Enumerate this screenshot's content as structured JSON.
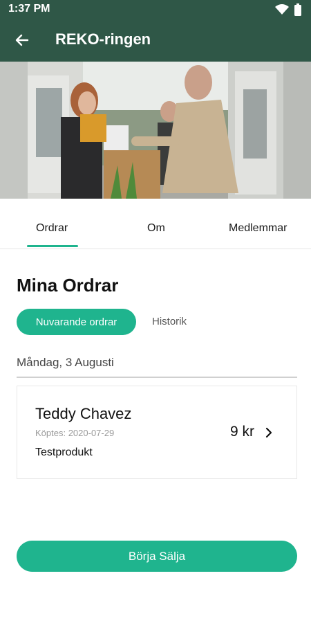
{
  "status_bar": {
    "time": "1:37 PM",
    "icons": [
      "wifi-icon",
      "battery-icon"
    ]
  },
  "app_bar": {
    "back_icon": "arrow-left-icon",
    "title": "REKO-ringen"
  },
  "hero_image": {
    "description_icon": "hero-photo"
  },
  "tabs": [
    {
      "label": "Ordrar",
      "selected": true
    },
    {
      "label": "Om",
      "selected": false
    },
    {
      "label": "Medlemmar",
      "selected": false
    }
  ],
  "orders_section": {
    "title": "Mina Ordrar",
    "filters": [
      {
        "label": "Nuvarande ordrar",
        "selected": true
      },
      {
        "label": "Historik",
        "selected": false
      }
    ],
    "date_group": "Måndag, 3 Augusti",
    "orders": [
      {
        "buyer": "Teddy Chavez",
        "purchased": "Köptes: 2020-07-29",
        "product": "Testprodukt",
        "price": "9 kr",
        "chevron_icon": "chevron-right-icon"
      }
    ]
  },
  "cta": {
    "label": "Börja Sälja"
  },
  "colors": {
    "primary_dark": "#2f5747",
    "accent": "#1fb48e"
  }
}
